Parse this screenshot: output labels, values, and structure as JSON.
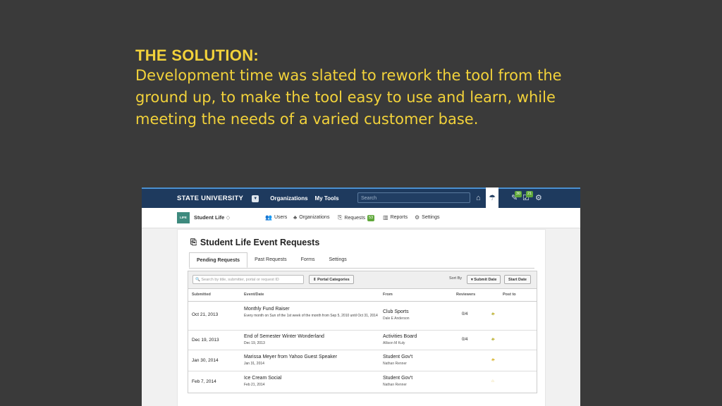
{
  "slide": {
    "title": "THE SOLUTION:",
    "body": "Development time was slated to rework the tool from the ground up, to make the tool easy to use and learn, while meeting the needs of a varied customer base."
  },
  "app": {
    "brand": "STATE UNIVERSITY",
    "nav": [
      "Organizations",
      "My Tools"
    ],
    "search_placeholder": "Search",
    "badges": {
      "messages": "30",
      "tasks": "21"
    },
    "org": {
      "logo_text": "LIFE",
      "name": "Student Life",
      "chevron": "◇"
    },
    "org_nav": {
      "users": "Users",
      "organizations": "Organizations",
      "requests": "Requests",
      "requests_count": "53",
      "reports": "Reports",
      "settings": "Settings"
    },
    "page_title": "Student Life Event Requests",
    "tabs": [
      "Pending Requests",
      "Past Requests",
      "Forms",
      "Settings"
    ],
    "filters": {
      "search_placeholder": "Search by title, submitter, portal or request ID",
      "categories": "Portal Categories",
      "sort_label": "Sort By",
      "sort_submit": "Submit Date",
      "sort_start": "Start Date"
    },
    "columns": [
      "Submitted",
      "Event/Date",
      "From",
      "Reviewers",
      "Post to"
    ],
    "rows": [
      {
        "submitted": "Oct 21, 2013",
        "event": "Monthly Fund Raiser",
        "event_sub": "Every month on Sun of the 1st week of the month from Sep 5, 2010 until Oct 31, 2014",
        "from": "Club Sports",
        "from_sub": "Dale E Anderson",
        "reviewers": "0/4"
      },
      {
        "submitted": "Dec 19, 2013",
        "event": "End of Semester Winter Wonderland",
        "event_sub": "Dec 19, 2013",
        "from": "Activities Board",
        "from_sub": "Allison M Kuly",
        "reviewers": "0/4"
      },
      {
        "submitted": "Jan 30, 2014",
        "event": "Marissa Meyer from Yahoo Guest Speaker",
        "event_sub": "Jan 31, 2014",
        "from": "Student Gov't",
        "from_sub": "Nathan Renner",
        "reviewers": ""
      },
      {
        "submitted": "Feb 7, 2014",
        "event": "Ice Cream Social",
        "event_sub": "Feb 21, 2014",
        "from": "Student Gov't",
        "from_sub": "Nathan Renner",
        "reviewers": ""
      }
    ]
  }
}
